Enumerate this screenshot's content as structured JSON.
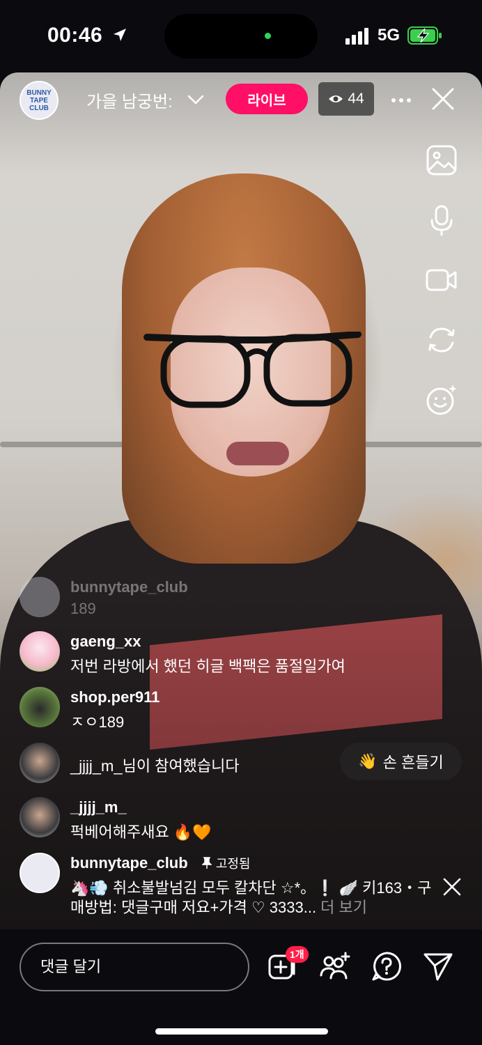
{
  "status_bar": {
    "time": "00:46",
    "network": "5G"
  },
  "header": {
    "title": "가을 남궁번:",
    "live_label": "라이브",
    "viewer_count": "44"
  },
  "comments": [
    {
      "user": "bunnytape_club",
      "text": "189",
      "faded": true
    },
    {
      "user": "gaeng_xx",
      "text": "저번 라방에서 했던 히글 백팩은 품절일가여"
    },
    {
      "user": "shop.per911",
      "text": "ㅈㅇ189"
    },
    {
      "join_text": "_jjjj_m_님이 참여했습니다"
    },
    {
      "user": "_jjjj_m_",
      "text": "퍽베어해주새요 🔥🧡"
    }
  ],
  "wave_button": {
    "emoji": "👋",
    "label": "손 흔들기"
  },
  "pinned": {
    "user": "bunnytape_club",
    "pinned_label": "고정됨",
    "line1": "🦄💨 취소불발넘김 모두 칼차단 ☆*。❕ 🪽 키163・구",
    "line2": "매방법: 댓글구매 저요+가격 ♡ 3333...",
    "more": " 더 보기"
  },
  "bottom_bar": {
    "comment_placeholder": "댓글 달기",
    "badge": "1개"
  },
  "colors": {
    "live": "#ff0f65",
    "badge": "#ff1f48",
    "background": "#0b0b0f"
  }
}
